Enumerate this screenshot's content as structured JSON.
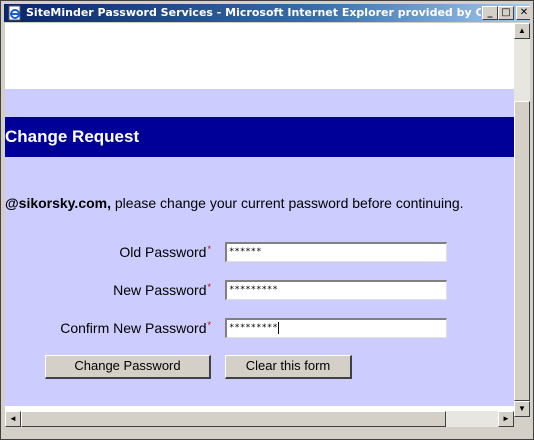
{
  "window": {
    "title": "SiteMinder Password Services - Microsoft Internet Explorer provided by CSC fo...",
    "minimize_glyph": "_",
    "maximize_glyph": "□",
    "close_glyph": "✕"
  },
  "page": {
    "banner_title": "Change Request",
    "message_user": "@sikorsky.com,",
    "message_text": " please change your current password before continuing."
  },
  "form": {
    "old_password": {
      "label": "Old Password",
      "value": "******"
    },
    "new_password": {
      "label": "New Password",
      "value": "*********"
    },
    "confirm_password": {
      "label": "Confirm New Password",
      "value": "*********"
    },
    "required_marker": "*",
    "change_button": "Change Password",
    "clear_button": "Clear this form"
  },
  "colors": {
    "banner": "#000099",
    "form_background": "#ccccff",
    "required_marker": "#cc0000"
  },
  "icons": {
    "title_icon": "ie-page-icon",
    "scroll_up": "▲",
    "scroll_down": "▼",
    "scroll_left": "◄",
    "scroll_right": "►"
  }
}
